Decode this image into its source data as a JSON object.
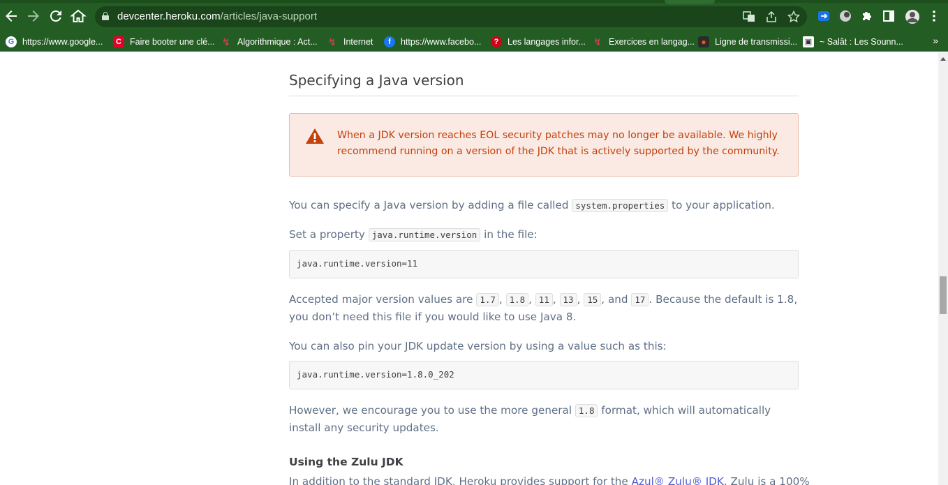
{
  "browser": {
    "url_host": "devcenter.heroku.com",
    "url_path": "/articles/java-support",
    "nav": {
      "back_icon": "arrow-left-icon",
      "forward_icon": "arrow-right-icon",
      "reload_icon": "reload-icon",
      "home_icon": "home-icon"
    },
    "bookmarks": [
      {
        "label": "https://www.google...",
        "icon": "google-icon",
        "color": "#ffffff",
        "glyph": "G"
      },
      {
        "label": "Faire booter une clé...",
        "icon": "c-red-icon",
        "color": "#e4002b",
        "glyph": "C"
      },
      {
        "label": "Algorithmique : Act...",
        "icon": "openclassrooms-icon",
        "color": "#7a1f2b",
        "glyph": "↯"
      },
      {
        "label": "Internet",
        "icon": "openclassrooms-icon",
        "color": "#7a1f2b",
        "glyph": "↯"
      },
      {
        "label": "https://www.facebo...",
        "icon": "facebook-icon",
        "color": "#1877f2",
        "glyph": "f"
      },
      {
        "label": "Les langages infor...",
        "icon": "question-icon",
        "color": "#d0021b",
        "glyph": "?"
      },
      {
        "label": "Exercices en langag...",
        "icon": "openclassrooms-icon",
        "color": "#7a1f2b",
        "glyph": "↯"
      },
      {
        "label": "Ligne de transmissi...",
        "icon": "orange-dot-icon",
        "color": "#e8590c",
        "glyph": "●"
      },
      {
        "label": "~ Salât : Les Sounn...",
        "icon": "site-icon",
        "color": "#333333",
        "glyph": "▣"
      }
    ]
  },
  "article": {
    "section_title": "Specifying a Java version",
    "warning": "When a JDK version reaches EOL security patches may no longer be available. We highly recommend running on a version of the JDK that is actively supported by the community.",
    "p1_pre": "You can specify a Java version by adding a file called ",
    "p1_code": "system.properties",
    "p1_post": " to your application.",
    "p2_pre": "Set a property ",
    "p2_code": "java.runtime.version",
    "p2_post": " in the file:",
    "code1": "java.runtime.version=11",
    "p3_pre": "Accepted major version values are ",
    "p3_v1": "1.7",
    "p3_v2": "1.8",
    "p3_v3": "11",
    "p3_v4": "13",
    "p3_v5": "15",
    "p3_and": ", and ",
    "p3_v6": "17",
    "p3_post": ". Because the default is 1.8, you don’t need this file if you would like to use Java 8.",
    "p4": "You can also pin your JDK update version by using a value such as this:",
    "code2": "java.runtime.version=1.8.0_202",
    "p5_pre": "However, we encourage you to use the more general ",
    "p5_code": "1.8",
    "p5_post": " format, which will automatically install any security updates.",
    "subheading": "Using the Zulu JDK",
    "p6_pre": "In addition to the standard JDK, Heroku provides support for the ",
    "p6_link": "Azul® Zulu® JDK",
    "p6_post": ". Zulu is a 100%"
  },
  "colors": {
    "chrome_green": "#245d24",
    "warning_bg": "#fbeae4",
    "warning_text": "#c2410c",
    "link": "#4f5bd5"
  }
}
